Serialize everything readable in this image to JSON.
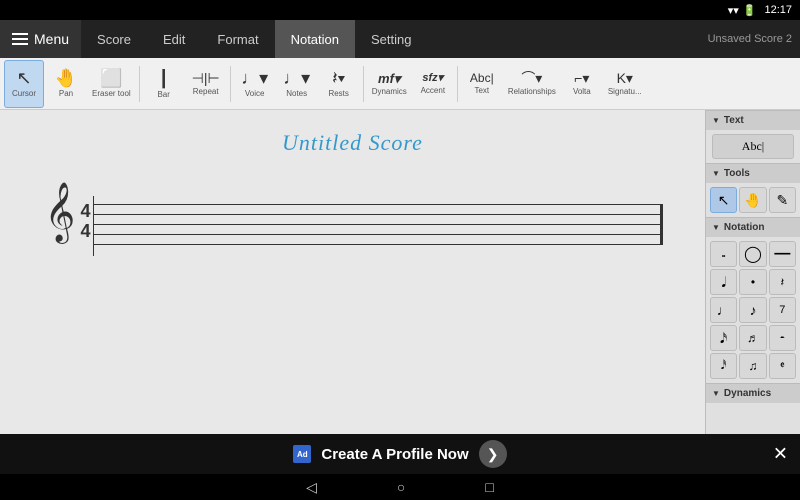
{
  "statusBar": {
    "time": "12:17",
    "icons": [
      "wifi",
      "battery"
    ]
  },
  "menuBar": {
    "menuLabel": "Menu",
    "tabs": [
      "Score",
      "Edit",
      "Format",
      "Notation",
      "Setting"
    ],
    "activeTab": "Notation",
    "unsavedLabel": "Unsaved Score 2"
  },
  "toolbar": {
    "tools": [
      {
        "id": "cursor",
        "icon": "↖",
        "label": "Cursor",
        "active": true
      },
      {
        "id": "pan",
        "icon": "✋",
        "label": "Pan",
        "active": false
      },
      {
        "id": "eraser",
        "icon": "⬜",
        "label": "Eraser tool",
        "active": false
      },
      {
        "id": "bar",
        "icon": "|",
        "label": "Bar",
        "active": false
      },
      {
        "id": "repeat",
        "icon": "⟨|⟩",
        "label": "Repeat",
        "active": false
      },
      {
        "id": "voice",
        "icon": "♩",
        "label": "Voice",
        "active": false
      },
      {
        "id": "notes",
        "icon": "♩",
        "label": "Notes",
        "active": false
      },
      {
        "id": "rests",
        "icon": "𝄽",
        "label": "Rests",
        "active": false
      },
      {
        "id": "dynamics",
        "icon": "mf",
        "label": "Dynamics",
        "active": false
      },
      {
        "id": "accent",
        "icon": "sfz",
        "label": "Accent",
        "active": false
      },
      {
        "id": "text",
        "icon": "Abc|",
        "label": "Text",
        "active": false
      },
      {
        "id": "relationships",
        "icon": "⌒",
        "label": "Relationships",
        "active": false
      },
      {
        "id": "volta",
        "icon": "⌐",
        "label": "Volta",
        "active": false
      },
      {
        "id": "signature",
        "icon": "♯",
        "label": "Signatu...",
        "active": false
      }
    ]
  },
  "score": {
    "title": "Untitled Score"
  },
  "rightPanel": {
    "textSection": "Text",
    "textBtnLabel": "Abc|",
    "toolsSection": "Tools",
    "tools": [
      {
        "icon": "↖",
        "selected": true
      },
      {
        "icon": "✋",
        "selected": false
      },
      {
        "icon": "✏",
        "selected": false
      }
    ],
    "notationSection": "Notation",
    "notationBtns": [
      "𝅝",
      "𝅗",
      "—",
      "𝅘𝅥",
      "•",
      "𝄽",
      "♩",
      "♪",
      "𝆹𝅥𝅮",
      "𝅘𝅥𝅯",
      "♬",
      "𝄼",
      "𝅘𝅥𝅰",
      "𝄩",
      "𝄵"
    ],
    "dynamicsSection": "Dynamics"
  },
  "adBanner": {
    "adIcon": "Ad",
    "text": "Create A Profile Now",
    "arrowIcon": "❯",
    "closeIcon": "✕"
  },
  "navBar": {
    "backIcon": "◁",
    "homeIcon": "○",
    "recentIcon": "□"
  }
}
